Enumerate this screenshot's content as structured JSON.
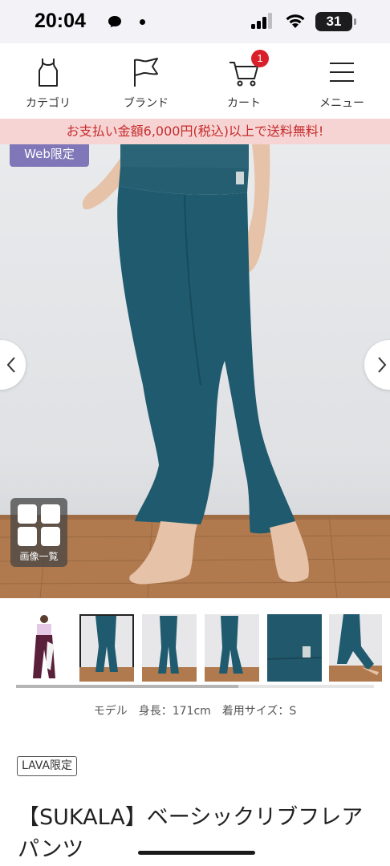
{
  "status_bar": {
    "time": "20:04",
    "battery": "31",
    "battery_level": 0.31
  },
  "nav": {
    "items": [
      {
        "label": "カテゴリ",
        "icon": "tank-top-icon"
      },
      {
        "label": "ブランド",
        "icon": "flag-icon"
      },
      {
        "label": "カート",
        "icon": "cart-icon"
      },
      {
        "label": "メニュー",
        "icon": "menu-icon"
      }
    ],
    "cart_count": "1"
  },
  "banner": {
    "text": "お支払い金額6,000円(税込)以上で送料無料!"
  },
  "hero": {
    "web_badge": "Web限定",
    "grid_label": "画像一覧"
  },
  "thumbnails": {
    "count": 7,
    "active_index": 1,
    "scroll_fraction": 0.62
  },
  "product": {
    "model_info": "モデル　身長：171cm　着用サイズ：S",
    "lava_badge": "LAVA限定",
    "title": "【SUKALA】ベーシックリブフレアパンツ"
  },
  "colors": {
    "accent_banner_bg": "#f7d4d4",
    "accent_banner_text": "#c62c2c",
    "badge_purple": "#7f77b8",
    "cart_badge": "#d9202a",
    "pants_teal": "#1f5a6e"
  }
}
